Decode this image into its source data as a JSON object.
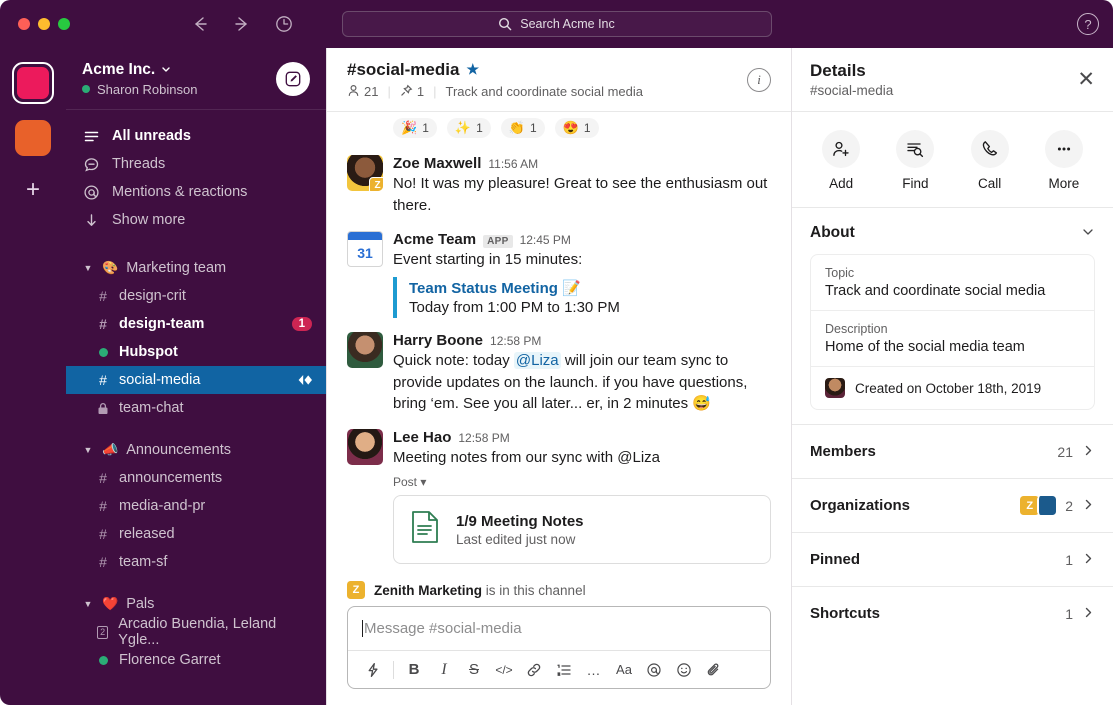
{
  "titlebar": {
    "back_icon": "arrow-left-icon",
    "forward_icon": "arrow-right-icon",
    "history_icon": "clock-icon",
    "search_placeholder": "Search Acme Inc",
    "search_icon": "search-icon",
    "help_label": "?"
  },
  "rail": {
    "active_workspace_color": "#EC1A5C",
    "second_workspace_color": "#E8612A",
    "add_label": "+"
  },
  "sidebar": {
    "workspace_name": "Acme Inc.",
    "workspace_caret": "⌄",
    "user_name": "Sharon Robinson",
    "compose_icon": "compose-pencil-icon",
    "nav": [
      {
        "label": "All unreads",
        "icon": "unreads-lines-icon",
        "bold": true
      },
      {
        "label": "Threads",
        "icon": "threads-bubble-icon",
        "bold": false
      },
      {
        "label": "Mentions & reactions",
        "icon": "at-icon",
        "bold": false
      },
      {
        "label": "Show more",
        "icon": "arrow-down-icon",
        "bold": false
      }
    ],
    "groups": [
      {
        "emoji": "🎨",
        "name": "Marketing team",
        "channels": [
          {
            "glyph": "#",
            "name": "design-crit",
            "state": "normal"
          },
          {
            "glyph": "#",
            "name": "design-team",
            "state": "unread",
            "badge": "1"
          },
          {
            "glyph": "dot",
            "name": "Hubspot",
            "state": "unread"
          },
          {
            "glyph": "#",
            "name": "social-media",
            "state": "selected",
            "huddle": true
          },
          {
            "glyph": "🔒",
            "name": "team-chat",
            "state": "normal"
          }
        ]
      },
      {
        "emoji": "📣",
        "name": "Announcements",
        "channels": [
          {
            "glyph": "#",
            "name": "announcements",
            "state": "normal"
          },
          {
            "glyph": "#",
            "name": "media-and-pr",
            "state": "normal"
          },
          {
            "glyph": "#",
            "name": "released",
            "state": "normal"
          },
          {
            "glyph": "#",
            "name": "team-sf",
            "state": "normal"
          }
        ]
      },
      {
        "emoji": "❤️",
        "name": "Pals",
        "channels": [
          {
            "glyph": "2",
            "name": "Arcadio Buendia, Leland Ygle...",
            "state": "normal"
          },
          {
            "glyph": "dot",
            "name": "Florence Garret",
            "state": "normal"
          }
        ]
      }
    ]
  },
  "channel": {
    "title": "#social-media",
    "starred": true,
    "members_count": "21",
    "pinned_count": "1",
    "topic": "Track and coordinate social media",
    "info_icon": "info-icon"
  },
  "reactions": [
    {
      "emoji": "🎉",
      "count": "1",
      "name": "tada"
    },
    {
      "emoji": "✨",
      "count": "1",
      "name": "sparkles"
    },
    {
      "emoji": "👏",
      "count": "1",
      "name": "clap"
    },
    {
      "emoji": "😍",
      "count": "1",
      "name": "heart-eyes"
    }
  ],
  "messages": [
    {
      "author": "Zoe Maxwell",
      "time": "11:56 AM",
      "text": "No! It was my pleasure! Great to see the enthusiasm out there.",
      "app_badge": "Z"
    },
    {
      "author": "Acme Team",
      "app_tag": "APP",
      "time": "12:45 PM",
      "text": "Event starting in 15 minutes:",
      "calendar_day": "31",
      "event": {
        "title": "Team Status Meeting",
        "emoji": "📝",
        "time": "Today from 1:00 PM to 1:30 PM"
      }
    },
    {
      "author": "Harry Boone",
      "time": "12:58 PM",
      "text_before": "Quick note: today ",
      "mention": "@Liza",
      "text_after": " will join our team sync to provide updates on the launch. if you have questions, bring ‘em. See you all later... er, in 2 minutes 😅"
    },
    {
      "author": "Lee Hao",
      "time": "12:58 PM",
      "text": "Meeting notes from our sync with @Liza",
      "post_tag": "Post",
      "post": {
        "title": "1/9 Meeting Notes",
        "subtitle": "Last edited just now",
        "icon": "document-icon"
      }
    }
  ],
  "in_channel": {
    "badge": "Z",
    "name": "Zenith Marketing",
    "suffix": " is in this channel"
  },
  "composer": {
    "placeholder": "Message #social-media",
    "tools": [
      {
        "name": "lightning-shortcut-icon",
        "glyph": "⚡",
        "kind": "icon"
      },
      {
        "name": "bold-icon",
        "glyph": "B",
        "kind": "bold"
      },
      {
        "name": "italic-icon",
        "glyph": "I",
        "kind": "ital"
      },
      {
        "name": "strikethrough-icon",
        "glyph": "S",
        "kind": "strike"
      },
      {
        "name": "code-icon",
        "glyph": "</>",
        "kind": "code"
      },
      {
        "name": "link-icon",
        "glyph": "🔗",
        "kind": "icon"
      },
      {
        "name": "ordered-list-icon",
        "glyph": "≣",
        "kind": "icon"
      },
      {
        "name": "more-formatting-icon",
        "glyph": "…",
        "kind": "icon"
      },
      {
        "name": "text-format-icon",
        "glyph": "Aa",
        "kind": "aa"
      },
      {
        "name": "mention-icon",
        "glyph": "@",
        "kind": "icon"
      },
      {
        "name": "emoji-icon",
        "glyph": "☺",
        "kind": "icon"
      },
      {
        "name": "attachment-icon",
        "glyph": "📎",
        "kind": "icon"
      }
    ]
  },
  "details": {
    "title": "Details",
    "subtitle": "#social-media",
    "close_label": "✕",
    "actions": [
      {
        "label": "Add",
        "icon": "add-person-icon"
      },
      {
        "label": "Find",
        "icon": "find-in-channel-icon"
      },
      {
        "label": "Call",
        "icon": "phone-icon"
      },
      {
        "label": "More",
        "icon": "more-dots-icon"
      }
    ],
    "about": {
      "heading": "About",
      "topic_label": "Topic",
      "topic_value": "Track and coordinate social media",
      "description_label": "Description",
      "description_value": "Home of the social media team",
      "created_text": "Created on October 18th, 2019"
    },
    "rows": [
      {
        "label": "Members",
        "value": "21",
        "chips": null
      },
      {
        "label": "Organizations",
        "value": "2",
        "chips": [
          {
            "letter": "Z",
            "color": "#ECB22E"
          },
          {
            "letter": "",
            "color": "#1B5A8C"
          }
        ]
      },
      {
        "label": "Pinned",
        "value": "1",
        "chips": null
      },
      {
        "label": "Shortcuts",
        "value": "1",
        "chips": null
      }
    ]
  }
}
